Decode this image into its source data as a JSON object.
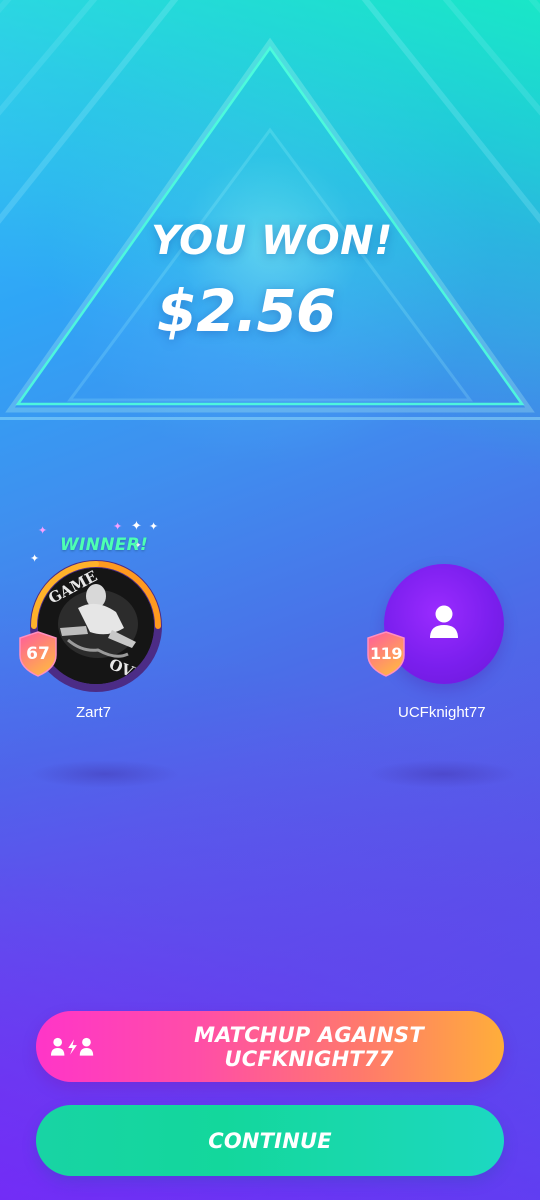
{
  "result": {
    "title": "YOU WON!",
    "amount": "$2.56"
  },
  "players": {
    "left": {
      "name": "Zart7",
      "level": "67",
      "label": "WINNER!",
      "avatar_text": [
        "GAME",
        "OVER"
      ],
      "avatar": "game-over-photo-avatar"
    },
    "right": {
      "name": "UCFknight77",
      "level": "119",
      "avatar": "default-user-avatar"
    }
  },
  "buttons": {
    "matchup_label": "MATCHUP AGAINST UCFKNIGHT77",
    "continue_label": "CONTINUE"
  },
  "icons": {
    "matchup": "players-versus-icon",
    "default_avatar": "person-icon",
    "level_badge": "shield-badge-icon",
    "sparkles": "sparkle-icon"
  },
  "colors": {
    "winner_text": "#4dffb2",
    "badge_gradient": [
      "#ff5a9e",
      "#ffb347"
    ],
    "matchup_gradient": [
      "#ff35c8",
      "#ffae3a"
    ],
    "continue_gradient": [
      "#18d4a4",
      "#1cd8c2"
    ],
    "right_avatar": "#7b1fee"
  }
}
